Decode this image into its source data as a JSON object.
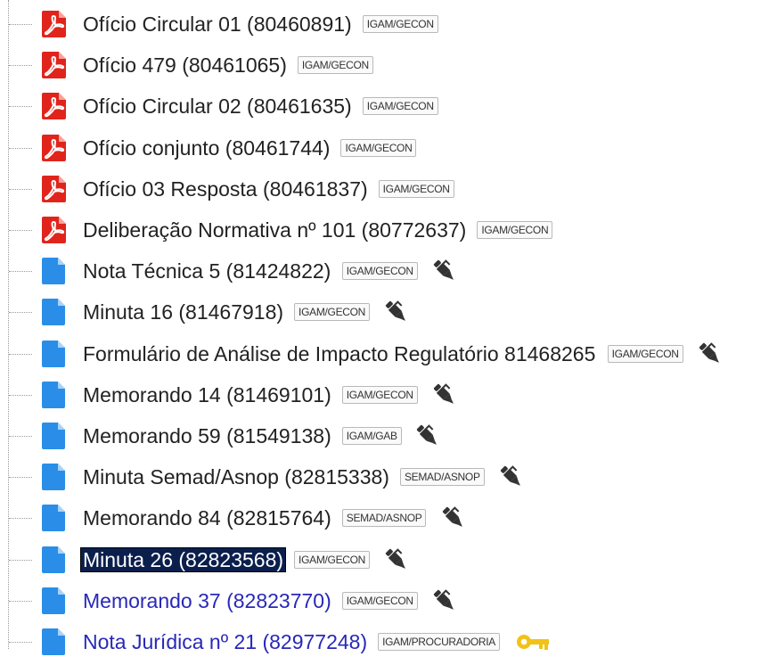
{
  "colors": {
    "pdf_red": "#e0241b",
    "doc_blue": "#2a8ee8",
    "visited_link": "#2828b8",
    "selected_bg": "#0b1f4d",
    "key_yellow": "#f2c218"
  },
  "documents": [
    {
      "title": "Ofício Circular 01 (80460891)",
      "unit": "IGAM/GECON",
      "icon": "pdf-icon",
      "action": "",
      "state": "normal"
    },
    {
      "title": "Ofício 479 (80461065)",
      "unit": "IGAM/GECON",
      "icon": "pdf-icon",
      "action": "",
      "state": "normal"
    },
    {
      "title": "Ofício Circular 02 (80461635)",
      "unit": "IGAM/GECON",
      "icon": "pdf-icon",
      "action": "",
      "state": "normal"
    },
    {
      "title": "Ofício conjunto (80461744)",
      "unit": "IGAM/GECON",
      "icon": "pdf-icon",
      "action": "",
      "state": "normal"
    },
    {
      "title": "Ofício 03 Resposta (80461837)",
      "unit": "IGAM/GECON",
      "icon": "pdf-icon",
      "action": "",
      "state": "normal"
    },
    {
      "title": "Deliberação Normativa nº 101 (80772637)",
      "unit": "IGAM/GECON",
      "icon": "pdf-icon",
      "action": "",
      "state": "normal"
    },
    {
      "title": "Nota Técnica 5 (81424822)",
      "unit": "IGAM/GECON",
      "icon": "document-icon",
      "action": "pen-icon",
      "state": "normal"
    },
    {
      "title": "Minuta 16 (81467918)",
      "unit": "IGAM/GECON",
      "icon": "document-icon",
      "action": "pen-icon",
      "state": "normal"
    },
    {
      "title": "Formulário de Análise de Impacto Regulatório 81468265",
      "unit": "IGAM/GECON",
      "icon": "document-icon",
      "action": "pen-icon",
      "state": "normal"
    },
    {
      "title": "Memorando 14 (81469101)",
      "unit": "IGAM/GECON",
      "icon": "document-icon",
      "action": "pen-icon",
      "state": "normal"
    },
    {
      "title": "Memorando 59 (81549138)",
      "unit": "IGAM/GAB",
      "icon": "document-icon",
      "action": "pen-icon",
      "state": "normal"
    },
    {
      "title": "Minuta Semad/Asnop (82815338)",
      "unit": "SEMAD/ASNOP",
      "icon": "document-icon",
      "action": "pen-icon",
      "state": "normal"
    },
    {
      "title": "Memorando 84 (82815764)",
      "unit": "SEMAD/ASNOP",
      "icon": "document-icon",
      "action": "pen-icon",
      "state": "normal"
    },
    {
      "title": "Minuta 26 (82823568)",
      "unit": "IGAM/GECON",
      "icon": "document-icon",
      "action": "pen-icon",
      "state": "selected"
    },
    {
      "title": "Memorando 37 (82823770)",
      "unit": "IGAM/GECON",
      "icon": "document-icon",
      "action": "pen-icon",
      "state": "visited"
    },
    {
      "title": "Nota Jurídica nº 21 (82977248)",
      "unit": "IGAM/PROCURADORIA",
      "icon": "document-icon",
      "action": "key-icon",
      "state": "visited"
    }
  ]
}
